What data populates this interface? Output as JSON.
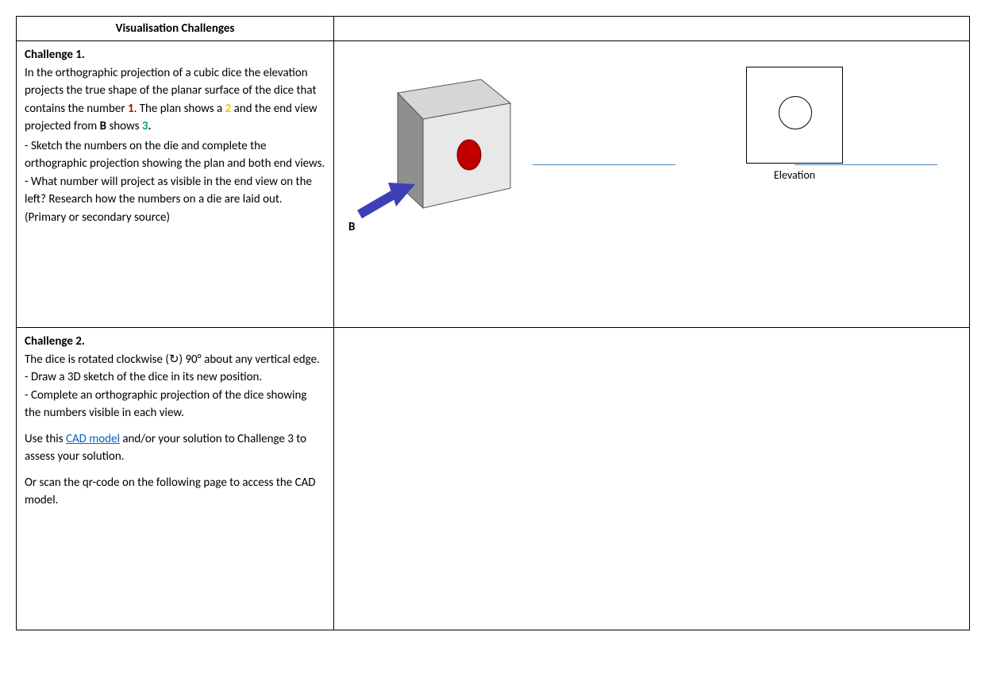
{
  "header": {
    "title": "Visualisation Challenges"
  },
  "challenge1": {
    "title": "Challenge 1.",
    "p1a": "In the orthographic projection of a cubic dice the elevation projects the true shape of the planar surface of the dice that contains the number ",
    "n1": "1",
    "p1b": ". The plan shows a ",
    "n2": "2",
    "p1c": " and the end view projected from ",
    "b_label": "B",
    "p1d": " shows ",
    "n3": "3",
    "p1e": ".",
    "p2": "- Sketch the numbers on the die and complete the orthographic projection showing the plan and both end views.",
    "p3": "- What number will project as visible in the end view on the left? Research how the numbers on a die are laid out.",
    "p4": "(Primary or secondary source)"
  },
  "challenge2": {
    "title": "Challenge 2.",
    "p1": "The dice is rotated clockwise (↻) 90° about any vertical edge.",
    "p2": "- Draw a 3D sketch of the dice in its new position.",
    "p3": "- Complete an orthographic projection of the dice showing the numbers visible in each view.",
    "p4a": "Use this ",
    "link": "CAD model",
    "p4b": " and/or your solution to Challenge 3 to assess your solution.",
    "p5": "Or scan the qr-code on the following page to access the CAD model."
  },
  "diagram": {
    "arrow_label": "B",
    "elevation_label": "Elevation"
  }
}
